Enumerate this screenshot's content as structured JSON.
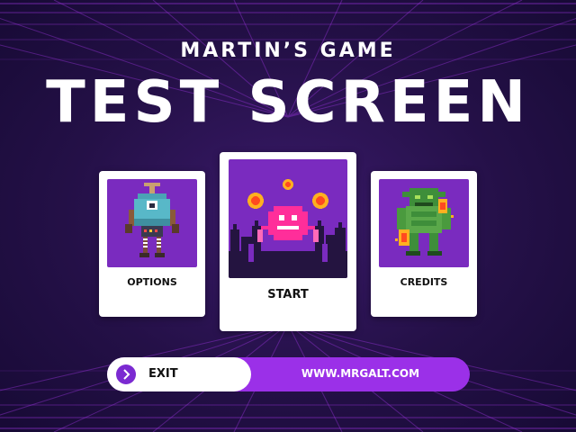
{
  "header": {
    "subtitle": "MARTIN’S GAME",
    "title": "TEST SCREEN"
  },
  "menu": {
    "cards": [
      {
        "label": "OPTIONS",
        "icon": "robot-icon"
      },
      {
        "label": "START",
        "icon": "pink-alien-icon"
      },
      {
        "label": "CREDITS",
        "icon": "green-monster-icon"
      }
    ]
  },
  "footer": {
    "exit_label": "EXIT",
    "exit_icon": "chevron-right-icon",
    "url": "WWW.MRGALT.COM"
  },
  "colors": {
    "background": "#231049",
    "card_art": "#7a2bbf",
    "accent": "#9b30e8",
    "grid": "#b53cff"
  }
}
